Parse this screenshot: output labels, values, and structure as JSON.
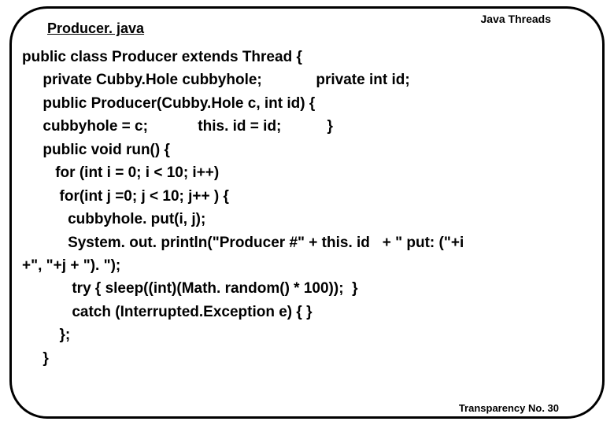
{
  "header": "Java Threads",
  "filename": "Producer. java",
  "code": {
    "l1": "public class Producer extends Thread {",
    "l2": "     private Cubby.Hole cubbyhole;             private int id;",
    "l3": "     public Producer(Cubby.Hole c, int id) {",
    "l4": "     cubbyhole = c;            this. id = id;           }",
    "l5": "     public void run() {",
    "l6": "        for (int i = 0; i < 10; i++)",
    "l7": "         for(int j =0; j < 10; j++ ) {",
    "l8": "           cubbyhole. put(i, j);",
    "l9": "           System. out. println(\"Producer #\" + this. id   + \" put: (\"+i",
    "l10": "+\", \"+j + \"). \");",
    "l11": "            try { sleep((int)(Math. random() * 100));  }",
    "l12": "            catch (Interrupted.Exception e) { }",
    "l13": "         };",
    "l14": "     }"
  },
  "footer": "Transparency No. 30"
}
